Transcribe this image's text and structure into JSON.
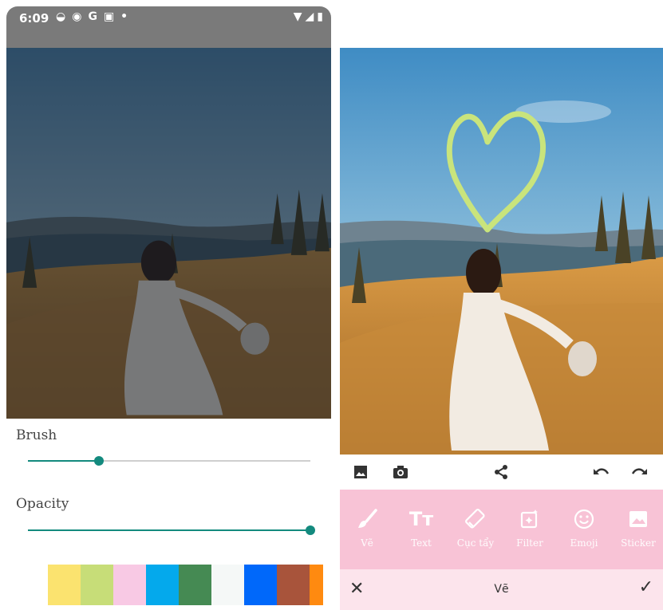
{
  "left_screen": {
    "status_bar": {
      "time": "6:09",
      "notification_icons": [
        "messenger-icon",
        "chrome-icon",
        "google-icon",
        "gallery-icon",
        "dot-icon"
      ],
      "right_icons": [
        "wifi-icon",
        "signal-icon",
        "battery-icon"
      ]
    },
    "brush_panel": {
      "brush_label": "Brush",
      "brush_value": 0.25,
      "opacity_label": "Opacity",
      "opacity_value": 1.0,
      "palette": [
        "#fbe36f",
        "#c7dd78",
        "#f8c9e4",
        "#04a9ec",
        "#458a53",
        "#f5f8f7",
        "#0068fa",
        "#a8543b",
        "#ff8a10"
      ]
    }
  },
  "right_screen": {
    "drawing": {
      "shape": "heart",
      "color": "#c9e47c"
    },
    "toolbar": {
      "icons": [
        "gallery-icon",
        "camera-icon",
        "share-icon",
        "undo-icon",
        "redo-icon"
      ]
    },
    "tools": [
      {
        "label": "Vẽ",
        "icon": "brush-icon"
      },
      {
        "label": "Text",
        "icon": "text-icon"
      },
      {
        "label": "Cục tẩy",
        "icon": "eraser-icon"
      },
      {
        "label": "Filter",
        "icon": "filter-icon"
      },
      {
        "label": "Emoji",
        "icon": "emoji-icon"
      },
      {
        "label": "Sticker",
        "icon": "sticker-icon"
      }
    ],
    "bottom_bar": {
      "title": "Vẽ"
    },
    "colors": {
      "tool_bar_bg": "#f8c3d6",
      "bottom_bar_bg": "#fce4ec",
      "accent": "#138a7e"
    }
  }
}
